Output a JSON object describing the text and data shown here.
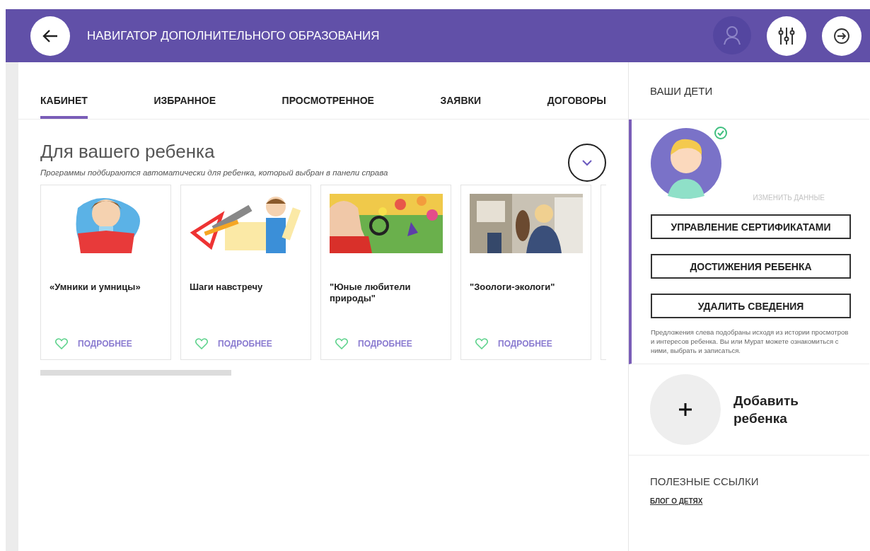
{
  "header": {
    "title": "НАВИГАТОР ДОПОЛНИТЕЛЬНОГО ОБРАЗОВАНИЯ"
  },
  "tabs": [
    {
      "label": "КАБИНЕТ",
      "selected": true
    },
    {
      "label": "ИЗБРАННОЕ",
      "selected": false
    },
    {
      "label": "ПРОСМОТРЕННОЕ",
      "selected": false
    },
    {
      "label": "ЗАЯВКИ",
      "selected": false
    },
    {
      "label": "ДОГОВОРЫ",
      "selected": false
    }
  ],
  "section": {
    "title": "Для вашего ребенка",
    "subtitle": "Программы подбираются автоматически для ребенка, который выбран в панели справа",
    "cards": [
      {
        "title": "«Умники и умницы»",
        "liked": false,
        "link": "ПОДРОБНЕЕ"
      },
      {
        "title": "Шаги навстречу",
        "liked": false,
        "link": "ПОДРОБНЕЕ"
      },
      {
        "title": "\"Юные любители природы\"",
        "liked": false,
        "link": "ПОДРОБНЕЕ"
      },
      {
        "title": "\"Зоологи-экологи\"",
        "liked": false,
        "link": "ПОДРОБНЕЕ"
      }
    ]
  },
  "children_panel": {
    "title": "ВАШИ ДЕТИ",
    "child": {
      "verified": true,
      "edit_link": "ИЗМЕНИТЬ ДАННЫЕ",
      "buttons": [
        "УПРАВЛЕНИЕ СЕРТИФИКАТАМИ",
        "ДОСТИЖЕНИЯ РЕБЕНКА",
        "УДАЛИТЬ СВЕДЕНИЯ"
      ],
      "note": "Предложения слева подобраны исходя из истории просмотров и интересов ребенка. Вы или Мурат можете ознакомиться с ними, выбрать и записаться."
    },
    "add_child": "Добавить ребенка",
    "links_title": "ПОЛЕЗНЫЕ ССЫЛКИ",
    "links": [
      "БЛОГ О ДЕТЯХ"
    ]
  }
}
